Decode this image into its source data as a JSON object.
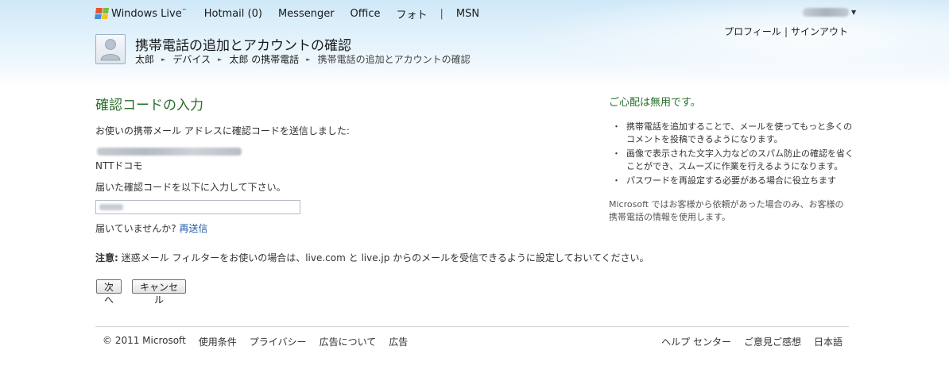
{
  "header": {
    "brand": "Windows Live",
    "brand_mark": "™",
    "nav": [
      "Hotmail (0)",
      "Messenger",
      "Office",
      "フォト"
    ],
    "nav_sep": "|",
    "nav_msn": "MSN",
    "account": {
      "profile": "プロフィール",
      "sep": "|",
      "signout": "サインアウト"
    },
    "title": "携帯電話の追加とアカウントの確認",
    "breadcrumb": [
      "太郎",
      "デバイス",
      "太郎 の携帯電話",
      "携帯電話の追加とアカウントの確認"
    ],
    "breadcrumb_arrow": "►"
  },
  "main": {
    "heading": "確認コードの入力",
    "sent_text": "お使いの携帯メール アドレスに確認コードを送信しました:",
    "carrier": "NTTドコモ",
    "instruction": "届いた確認コードを以下に入力して下さい。",
    "not_received": "届いていませんか?",
    "resend": "再送信",
    "note_label": "注意:",
    "note_text": "迷惑メール フィルターをお使いの場合は、live.com と live.jp からのメールを受信できるように設定しておいてください。",
    "next_button": "次へ",
    "cancel_button": "キャンセル"
  },
  "sidebar": {
    "heading": "ご心配は無用です。",
    "bullet": "・",
    "bullets": [
      "携帯電話を追加することで、メールを使ってもっと多くのコメントを投稿できるようになります。",
      "画像で表示された文字入力などのスパム防止の確認を省くことができ、スムーズに作業を行えるようになります。",
      "パスワードを再設定する必要がある場合に役立ちます"
    ],
    "note": "Microsoft ではお客様から依頼があった場合のみ、お客様の携帯電話の情報を使用します。"
  },
  "footer": {
    "left": [
      "© 2011 Microsoft",
      "使用条件",
      "プライバシー",
      "広告について",
      "広告"
    ],
    "right": [
      "ヘルプ センター",
      "ご意見ご感想",
      "日本語"
    ]
  },
  "colors": {
    "heading_green": "#2b6e2b",
    "link_blue": "#1f5ea8",
    "header_top": "#cfe8f8"
  },
  "icons": [
    "windows-flag-icon",
    "user-avatar-icon",
    "caret-down-icon",
    "breadcrumb-arrow-icon"
  ]
}
